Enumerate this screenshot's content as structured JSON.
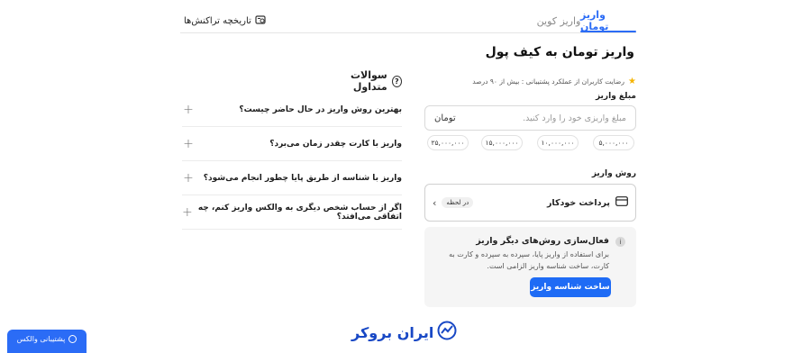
{
  "tabs": [
    {
      "label": "واریز تومان",
      "active": true
    },
    {
      "label": "واریز کوین",
      "active": false
    }
  ],
  "history_label": "تاریخچه تراکنش‌ها",
  "page_title": "واریز تومان به کیف پول",
  "faq": {
    "title": "سوالات متداول",
    "items": [
      "بهترین روش واریز در حال حاضر چیست؟",
      "واریز با کارت چقدر زمان می‌برد؟",
      "واریز با شناسه از طریق پایا چطور انجام می‌شود؟",
      "اگر از حساب شخص دیگری به والکس واریز کنم، چه اتفاقی می‌افتد؟"
    ]
  },
  "satisfaction": "رضایت کاربران از عملکرد پشتیبانی : بیش از ۹۰ درصد",
  "amount": {
    "label": "مبلغ واریز",
    "placeholder": "مبلغ واریزی خود را وارد کنید.",
    "unit": "تومان",
    "presets": [
      "۵,۰۰۰,۰۰۰",
      "۱۰,۰۰۰,۰۰۰",
      "۱۵,۰۰۰,۰۰۰",
      "۲۵,۰۰۰,۰۰۰"
    ]
  },
  "method": {
    "label": "روش واریز",
    "name": "پرداخت خودکار",
    "badge": "در لحظه"
  },
  "info": {
    "title": "فعال‌سازی روش‌های دیگر واریز",
    "text": "برای استفاده از واریز پایا، سپرده به سپرده و کارت به کارت، ساخت شناسه واریز الزامی است.",
    "button": "ساخت شناسه واریز"
  },
  "logo_text": "ایران بروکر",
  "floating_label": "پشتیبانی والکس",
  "colors": {
    "accent": "#2b6cf6",
    "star": "#f5b301",
    "logo": "#1848c5"
  }
}
